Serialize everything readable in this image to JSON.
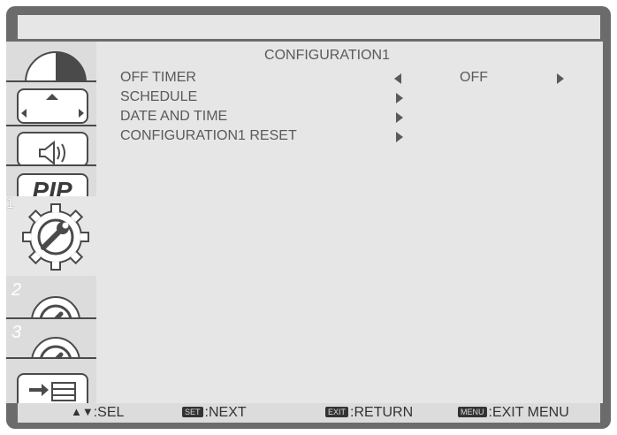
{
  "menu": {
    "title": "CONFIGURATION1",
    "items": [
      {
        "label": "OFF TIMER",
        "value": "OFF"
      },
      {
        "label": "SCHEDULE"
      },
      {
        "label": "DATE AND TIME"
      },
      {
        "label": "CONFIGURATION1 RESET"
      }
    ]
  },
  "sidebar": {
    "tabs": [
      {
        "icon": "picture-icon"
      },
      {
        "icon": "screen-icon"
      },
      {
        "icon": "audio-icon"
      },
      {
        "icon": "pip-icon",
        "text": "PIP"
      },
      {
        "icon": "configuration-1-icon",
        "number": "1"
      },
      {
        "icon": "configuration-2-icon",
        "number": "2"
      },
      {
        "icon": "configuration-3-icon",
        "number": "3"
      },
      {
        "icon": "advanced-option-icon"
      }
    ]
  },
  "footer": {
    "sel": ":SEL",
    "next_key": "SET",
    "next": ":NEXT",
    "return_key": "EXIT",
    "return": ":RETURN",
    "exit_key": "MENU",
    "exit": ":EXIT MENU"
  },
  "colors": {
    "frame": "#6b6b6b",
    "panel": "#e6e6e6",
    "text": "#5a5a5a"
  }
}
